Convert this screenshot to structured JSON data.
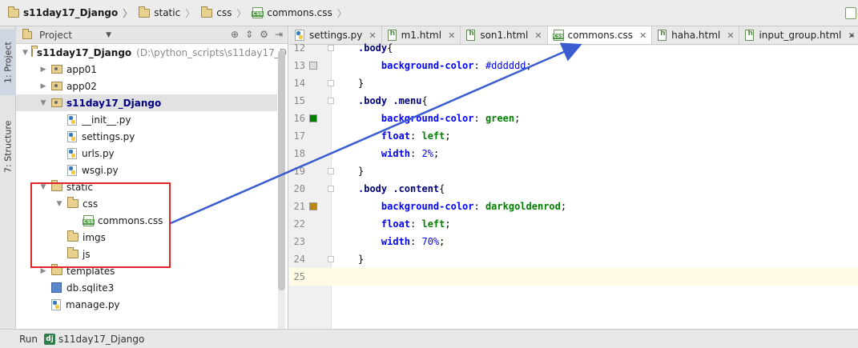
{
  "breadcrumb": [
    {
      "label": "s11day17_Django",
      "icon": "folder-icon"
    },
    {
      "label": "static",
      "icon": "folder-icon"
    },
    {
      "label": "css",
      "icon": "folder-icon"
    },
    {
      "label": "commons.css",
      "icon": "css-file-icon"
    }
  ],
  "toolstrip": {
    "project_tab": "1: Project",
    "structure_tab": "7: Structure"
  },
  "project_panel": {
    "title": "Project",
    "tree": [
      {
        "label": "s11day17_Django",
        "hint": "(D:\\python_scripts\\s11day17_D",
        "type": "folder",
        "depth": 0,
        "expanded": true
      },
      {
        "label": "app01",
        "type": "module",
        "depth": 1,
        "expanded": false
      },
      {
        "label": "app02",
        "type": "module",
        "depth": 1,
        "expanded": false
      },
      {
        "label": "s11day17_Django",
        "type": "module",
        "depth": 1,
        "expanded": true,
        "selected": true
      },
      {
        "label": "__init__.py",
        "type": "py",
        "depth": 2
      },
      {
        "label": "settings.py",
        "type": "py",
        "depth": 2
      },
      {
        "label": "urls.py",
        "type": "py",
        "depth": 2
      },
      {
        "label": "wsgi.py",
        "type": "py",
        "depth": 2
      },
      {
        "label": "static",
        "type": "folder",
        "depth": 1,
        "expanded": true
      },
      {
        "label": "css",
        "type": "folder",
        "depth": 2,
        "expanded": true
      },
      {
        "label": "commons.css",
        "type": "css",
        "depth": 3
      },
      {
        "label": "imgs",
        "type": "folder",
        "depth": 2
      },
      {
        "label": "js",
        "type": "folder",
        "depth": 2
      },
      {
        "label": "templates",
        "type": "folder",
        "depth": 1,
        "expanded": false
      },
      {
        "label": "db.sqlite3",
        "type": "db",
        "depth": 1
      },
      {
        "label": "manage.py",
        "type": "py",
        "depth": 1
      }
    ]
  },
  "editor_tabs": [
    {
      "label": "settings.py",
      "icon": "python-file-icon",
      "closable": true
    },
    {
      "label": "m1.html",
      "icon": "html-file-icon",
      "closable": true
    },
    {
      "label": "son1.html",
      "icon": "html-file-icon",
      "closable": true
    },
    {
      "label": "commons.css",
      "icon": "css-file-icon",
      "closable": true,
      "active": true
    },
    {
      "label": "haha.html",
      "icon": "html-file-icon",
      "closable": true
    },
    {
      "label": "input_group.html",
      "icon": "html-file-icon",
      "closable": true
    }
  ],
  "code_lines": [
    {
      "n": "12",
      "tokens": [
        [
          "sel",
          ".body"
        ],
        [
          "punct",
          "{"
        ]
      ]
    },
    {
      "n": "13",
      "tokens": [
        [
          "sp",
          "    "
        ],
        [
          "prop",
          "background-color"
        ],
        [
          "punct",
          ": "
        ],
        [
          "num",
          "#dddddd"
        ],
        [
          "punct",
          ";"
        ]
      ]
    },
    {
      "n": "14",
      "tokens": [
        [
          "punct",
          "}"
        ]
      ]
    },
    {
      "n": "15",
      "tokens": [
        [
          "sel",
          ".body .menu"
        ],
        [
          "punct",
          "{"
        ]
      ]
    },
    {
      "n": "16",
      "tokens": [
        [
          "sp",
          "    "
        ],
        [
          "prop",
          "background-color"
        ],
        [
          "punct",
          ": "
        ],
        [
          "val",
          "green"
        ],
        [
          "punct",
          ";"
        ]
      ]
    },
    {
      "n": "17",
      "tokens": [
        [
          "sp",
          "    "
        ],
        [
          "prop",
          "float"
        ],
        [
          "punct",
          ": "
        ],
        [
          "val",
          "left"
        ],
        [
          "punct",
          ";"
        ]
      ]
    },
    {
      "n": "18",
      "tokens": [
        [
          "sp",
          "    "
        ],
        [
          "prop",
          "width"
        ],
        [
          "punct",
          ": "
        ],
        [
          "num",
          "2%"
        ],
        [
          "punct",
          ";"
        ]
      ]
    },
    {
      "n": "19",
      "tokens": [
        [
          "punct",
          "}"
        ]
      ]
    },
    {
      "n": "20",
      "tokens": [
        [
          "sel",
          ".body .content"
        ],
        [
          "punct",
          "{"
        ]
      ]
    },
    {
      "n": "21",
      "tokens": [
        [
          "sp",
          "    "
        ],
        [
          "prop",
          "background-color"
        ],
        [
          "punct",
          ": "
        ],
        [
          "val",
          "darkgoldenrod"
        ],
        [
          "punct",
          ";"
        ]
      ]
    },
    {
      "n": "22",
      "tokens": [
        [
          "sp",
          "    "
        ],
        [
          "prop",
          "float"
        ],
        [
          "punct",
          ": "
        ],
        [
          "val",
          "left"
        ],
        [
          "punct",
          ";"
        ]
      ]
    },
    {
      "n": "23",
      "tokens": [
        [
          "sp",
          "    "
        ],
        [
          "prop",
          "width"
        ],
        [
          "punct",
          ": "
        ],
        [
          "num",
          "70%"
        ],
        [
          "punct",
          ";"
        ]
      ]
    },
    {
      "n": "24",
      "tokens": [
        [
          "punct",
          "}"
        ]
      ]
    },
    {
      "n": "25",
      "tokens": [],
      "current": true
    }
  ],
  "gutter_markers": {
    "13": "#dddddd",
    "16": "#008000",
    "21": "#b8860b"
  },
  "statusbar": {
    "run_label": "Run",
    "config_label": "s11day17_Django"
  },
  "colors": {
    "annotation_box": "#e0262a",
    "annotation_arrow": "#3b5bd0"
  }
}
